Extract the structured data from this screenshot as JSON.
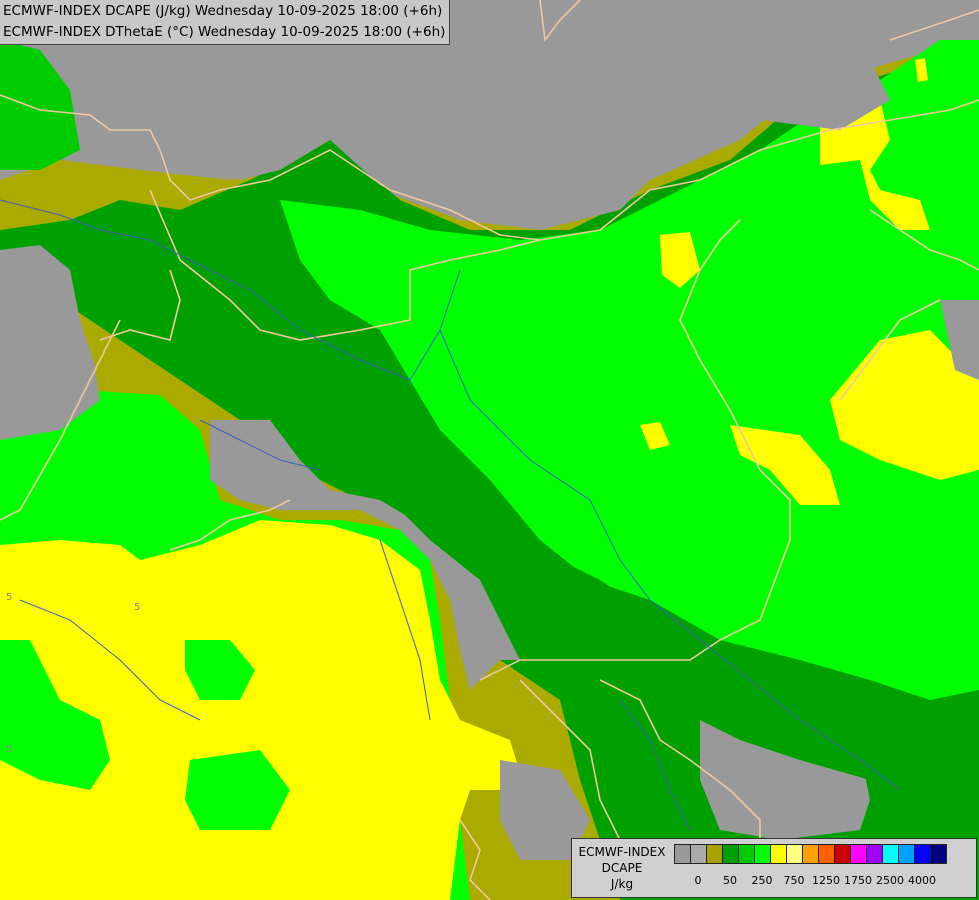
{
  "header": {
    "line1": "ECMWF-INDEX DCAPE (J/kg) Wednesday 10-09-2025 18:00 (+6h)",
    "line2": "ECMWF-INDEX DThetaE (°C) Wednesday 10-09-2025 18:00 (+6h)"
  },
  "legend": {
    "title1": "ECMWF-INDEX",
    "title2": "DCAPE",
    "unit": "J/kg",
    "colors": [
      "#999999",
      "#aaaaaa",
      "#aaa000",
      "#00a000",
      "#00cc00",
      "#00ff00",
      "#ffff00",
      "#ffff80",
      "#ffa000",
      "#ff6000",
      "#c80000",
      "#ff00ff",
      "#a000ff",
      "#00ffff",
      "#00a0ff",
      "#0000ff",
      "#000080"
    ],
    "tick_labels": [
      "0",
      "50",
      "250",
      "750",
      "1250",
      "1750",
      "2500",
      "4000"
    ]
  },
  "contour_labels": [
    "5",
    "5",
    "5"
  ],
  "colors": {
    "no_data": "#999999",
    "olive": "#aaaa00",
    "dark_green": "#00a000",
    "green": "#00cc00",
    "bright_green": "#00ff00",
    "yellow": "#ffff00",
    "border": "#f0c8a0",
    "river": "#4060c0"
  }
}
